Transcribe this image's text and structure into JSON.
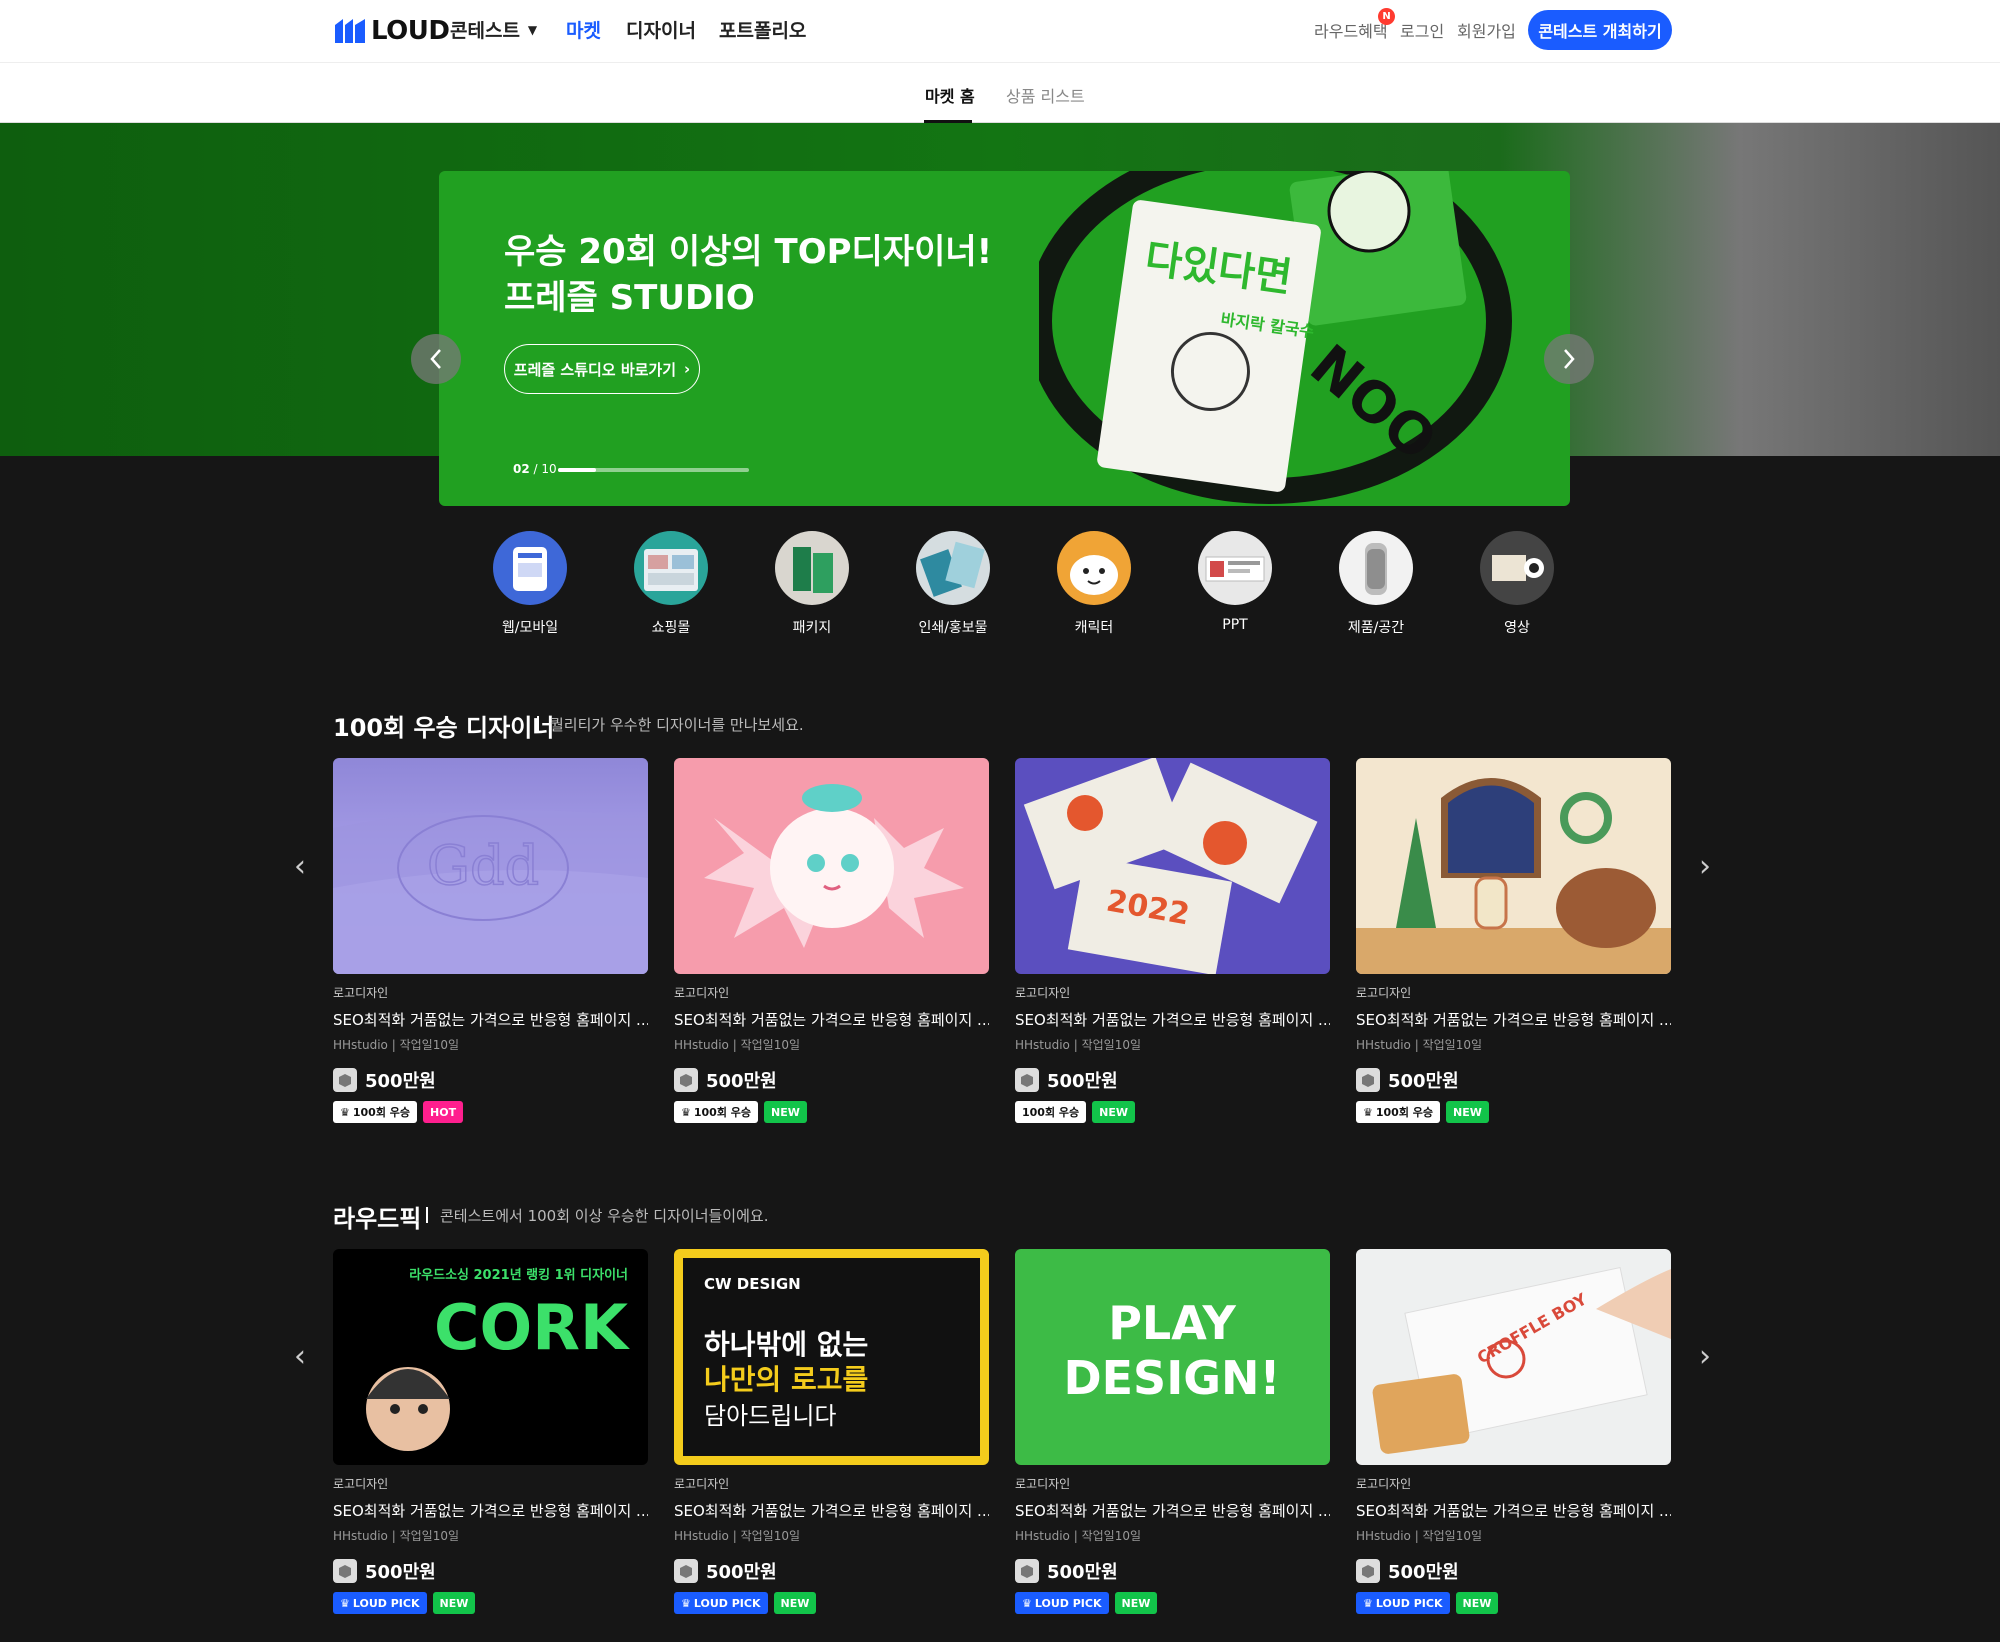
{
  "header": {
    "logo": "LOUD",
    "nav": [
      "콘테스트",
      "마켓",
      "디자이너",
      "포트폴리오"
    ],
    "benefits": "라우드혜택",
    "benefits_badge": "N",
    "login": "로그인",
    "signup": "회원가입",
    "host_button": "콘테스트 개최하기",
    "active_color": "#1a5cff"
  },
  "subnav": {
    "tabs": [
      "마켓 홈",
      "상품 리스트"
    ],
    "active": "마켓 홈"
  },
  "hero": {
    "line1": "우승 20회 이상의 TOP디자이너!",
    "line2": "프레즐 STUDIO",
    "button": "프레즐 스튜디오 바로가기",
    "counter_current": "02",
    "counter_total": "/ 10",
    "progress": 0.2,
    "bg_color": "#21a021",
    "art_text_main": "다있다면",
    "art_text_sub": "바지락 칼국수",
    "art_ring_text": "AITDA NOO"
  },
  "categories": [
    "웹/모바일",
    "쇼핑몰",
    "패키지",
    "인쇄/홍보물",
    "캐릭터",
    "PPT",
    "제품/공간",
    "영상"
  ],
  "section1": {
    "title": "100회 우승 디자이너",
    "subtitle": "퀄리티가 우수한 디자이너를 만나보세요.",
    "products": [
      {
        "category": "로고디자인",
        "title": "SEO최적화 거품없는 가격으로 반응형 홈페이지 ...",
        "studio": "HHstudio",
        "work": "작업일10일",
        "price": "500만원",
        "tag1": "100회 우승",
        "tag2": "HOT",
        "thumb_text": "Gdd"
      },
      {
        "category": "로고디자인",
        "title": "SEO최적화 거품없는 가격으로 반응형 홈페이지 ...",
        "studio": "HHstudio",
        "work": "작업일10일",
        "price": "500만원",
        "tag1": "100회 우승",
        "tag2": "NEW"
      },
      {
        "category": "로고디자인",
        "title": "SEO최적화 거품없는 가격으로 반응형 홈페이지 ...",
        "studio": "HHstudio",
        "work": "작업일10일",
        "price": "500만원",
        "tag1": "100회 우승",
        "tag2": "NEW",
        "thumb_text": "2022"
      },
      {
        "category": "로고디자인",
        "title": "SEO최적화 거품없는 가격으로 반응형 홈페이지 ...",
        "studio": "HHstudio",
        "work": "작업일10일",
        "price": "500만원",
        "tag1": "100회 우승",
        "tag2": "NEW"
      }
    ]
  },
  "section2": {
    "title": "라우드픽",
    "subtitle": "콘테스트에서 100회 이상 우승한 디자이너들이에요.",
    "products": [
      {
        "category": "로고디자인",
        "title": "SEO최적화 거품없는 가격으로 반응형 홈페이지 ...",
        "studio": "HHstudio",
        "work": "작업일10일",
        "price": "500만원",
        "tag1": "LOUD PICK",
        "tag2": "NEW",
        "thumb_top": "라우드소싱 2021년 랭킹 1위 디자이너",
        "thumb_main": "CORK"
      },
      {
        "category": "로고디자인",
        "title": "SEO최적화 거품없는 가격으로 반응형 홈페이지 ...",
        "studio": "HHstudio",
        "work": "작업일10일",
        "price": "500만원",
        "tag1": "LOUD PICK",
        "tag2": "NEW",
        "thumb_brand": "CW DESIGN",
        "thumb_l1": "하나밖에 없는",
        "thumb_l2": "나만의 로고를",
        "thumb_l3": "담아드립니다"
      },
      {
        "category": "로고디자인",
        "title": "SEO최적화 거품없는 가격으로 반응형 홈페이지 ...",
        "studio": "HHstudio",
        "work": "작업일10일",
        "price": "500만원",
        "tag1": "LOUD PICK",
        "tag2": "NEW",
        "thumb_l1": "PLAY",
        "thumb_l2": "DESIGN!"
      },
      {
        "category": "로고디자인",
        "title": "SEO최적화 거품없는 가격으로 반응형 홈페이지 ...",
        "studio": "HHstudio",
        "work": "작업일10일",
        "price": "500만원",
        "tag1": "LOUD PICK",
        "tag2": "NEW",
        "thumb_text": "CROFFLE BOY"
      }
    ]
  }
}
